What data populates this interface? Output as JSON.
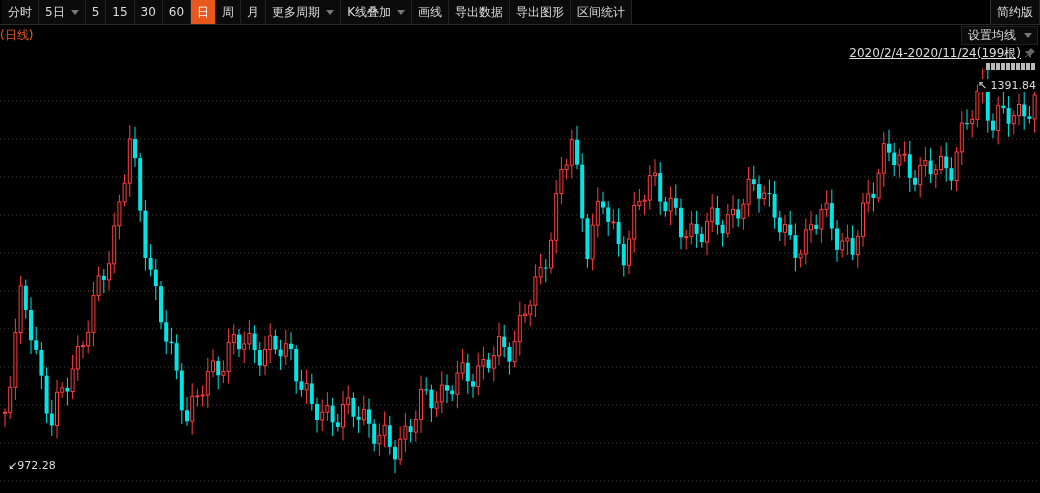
{
  "toolbar": {
    "items": [
      {
        "label": "分时",
        "kind": "button",
        "selected": false
      },
      {
        "label": "5日",
        "kind": "dropdown",
        "selected": false
      },
      {
        "label": "5",
        "kind": "button",
        "selected": false
      },
      {
        "label": "15",
        "kind": "button",
        "selected": false
      },
      {
        "label": "30",
        "kind": "button",
        "selected": false
      },
      {
        "label": "60",
        "kind": "button",
        "selected": false
      },
      {
        "label": "日",
        "kind": "button",
        "selected": true
      },
      {
        "label": "周",
        "kind": "button",
        "selected": false
      },
      {
        "label": "月",
        "kind": "button",
        "selected": false
      },
      {
        "label": "更多周期",
        "kind": "dropdown",
        "selected": false
      },
      {
        "label": "K线叠加",
        "kind": "dropdown",
        "selected": false
      },
      {
        "label": "画线",
        "kind": "button",
        "selected": false
      },
      {
        "label": "导出数据",
        "kind": "button",
        "selected": false
      },
      {
        "label": "导出图形",
        "kind": "button",
        "selected": false
      },
      {
        "label": "区间统计",
        "kind": "button",
        "selected": false
      }
    ],
    "mode_button": "简约版"
  },
  "chart": {
    "period_label": "(日线)",
    "ma_button": "设置均线",
    "date_range": "2020/2/4-2020/11/24(199根)",
    "high_label": "↖ 1391.84",
    "low_label": "↙972.28"
  }
}
